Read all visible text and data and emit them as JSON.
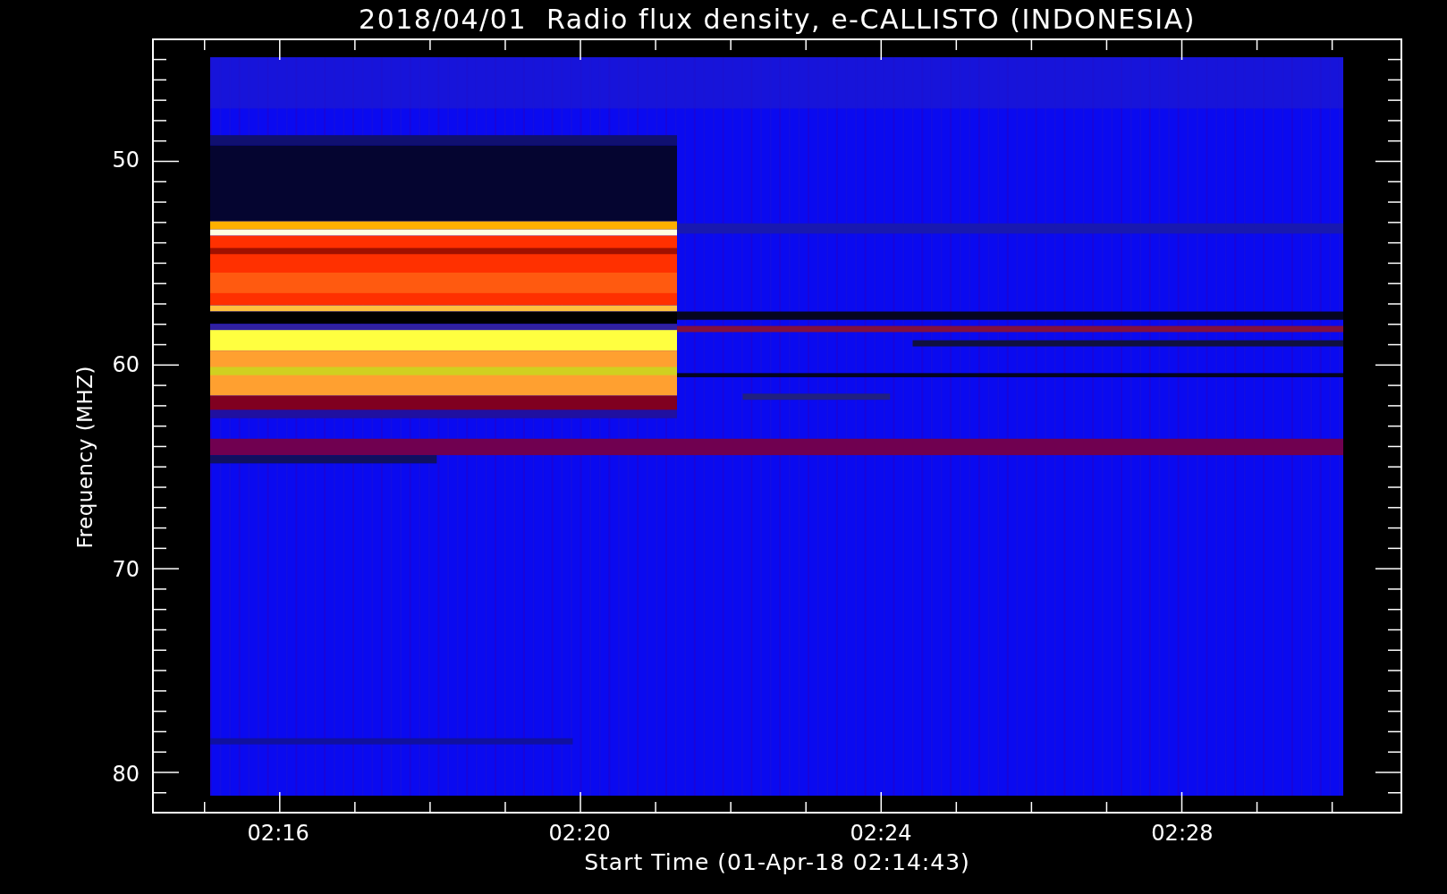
{
  "title": "2018/04/01  Radio flux density, e-CALLISTO (INDONESIA)",
  "y_axis": {
    "label": "Frequency (MHZ)",
    "ticks": [
      "50",
      "60",
      "70",
      "80"
    ]
  },
  "x_axis": {
    "label": "Start Time (01-Apr-18 02:14:43)",
    "ticks": [
      "02:16",
      "02:20",
      "02:24",
      "02:28"
    ]
  }
}
